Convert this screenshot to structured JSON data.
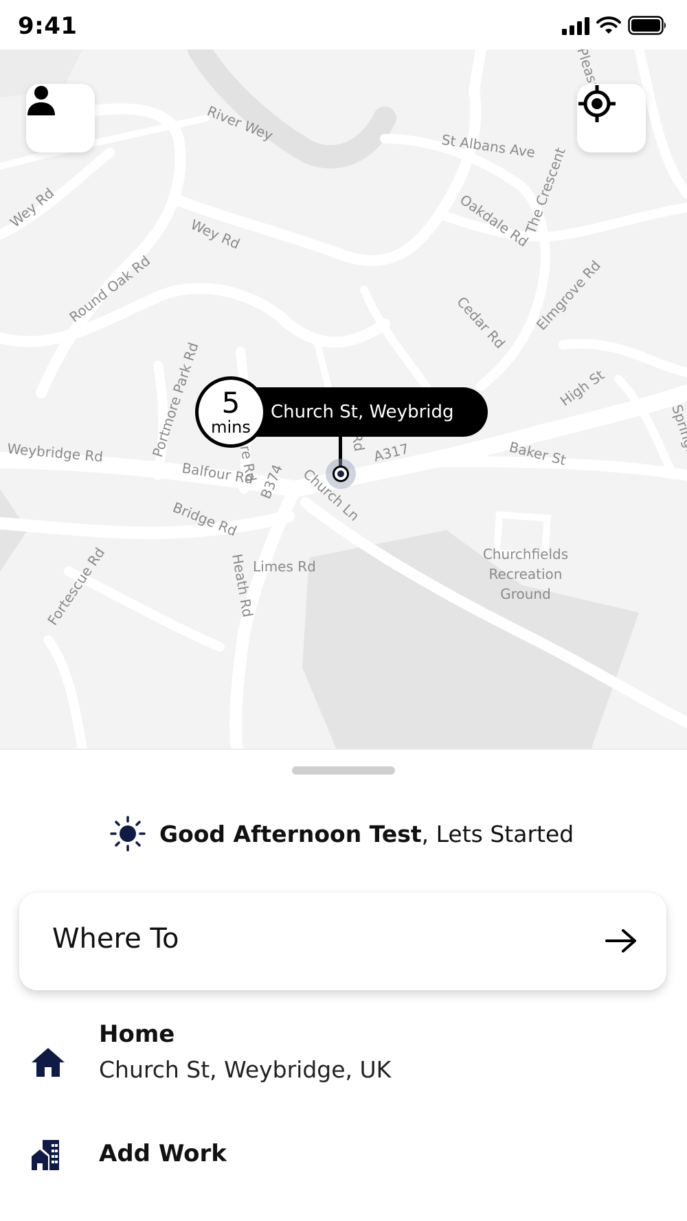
{
  "status_bar": {
    "time": "9:41",
    "icons": [
      "signal-icon",
      "wifi-icon",
      "battery-icon"
    ]
  },
  "map": {
    "streets": [
      "River Wey",
      "St Albans Ave",
      "Wey Rd",
      "Wey Rd",
      "Oakdale Rd",
      "The Crescent",
      "Round Oak Rd",
      "Cedar Rd",
      "Elmgrove Rd",
      "Portmore Park Rd",
      "High St",
      "Weybridge Rd",
      "Balfour Rd",
      "A317",
      "Baker St",
      "B374",
      "Church Ln",
      "Bridge Rd",
      "Limes Rd",
      "Heath Rd",
      "Fortescue Rd",
      "Churchfields",
      "Recreation",
      "Ground",
      "Springfield",
      "Pleasant",
      "re Rd",
      "Rd"
    ],
    "profile_button_icon": "person-icon",
    "locate_button_icon": "crosshair-icon"
  },
  "pickup": {
    "eta_value": "5",
    "eta_unit": "mins",
    "address": "Church St, Weybridg",
    "chevron_icon": "chevron-right-icon"
  },
  "sheet": {
    "greeting_icon": "sun-icon",
    "greeting_name": "Good Afternoon Test",
    "greeting_rest": ", Lets Started",
    "where_to": {
      "label": "Where To",
      "icon": "arrow-right-icon"
    },
    "saved_places": [
      {
        "title": "Home",
        "subtitle": "Church St, Weybridge, UK",
        "icon": "home-icon"
      },
      {
        "title": "Add Work",
        "icon": "building-icon"
      }
    ]
  },
  "colors": {
    "accent": "#0f1a45",
    "map_background": "#f3f3f3",
    "road": "#ffffff",
    "park": "#e4e4e4",
    "pin": "#000000"
  }
}
